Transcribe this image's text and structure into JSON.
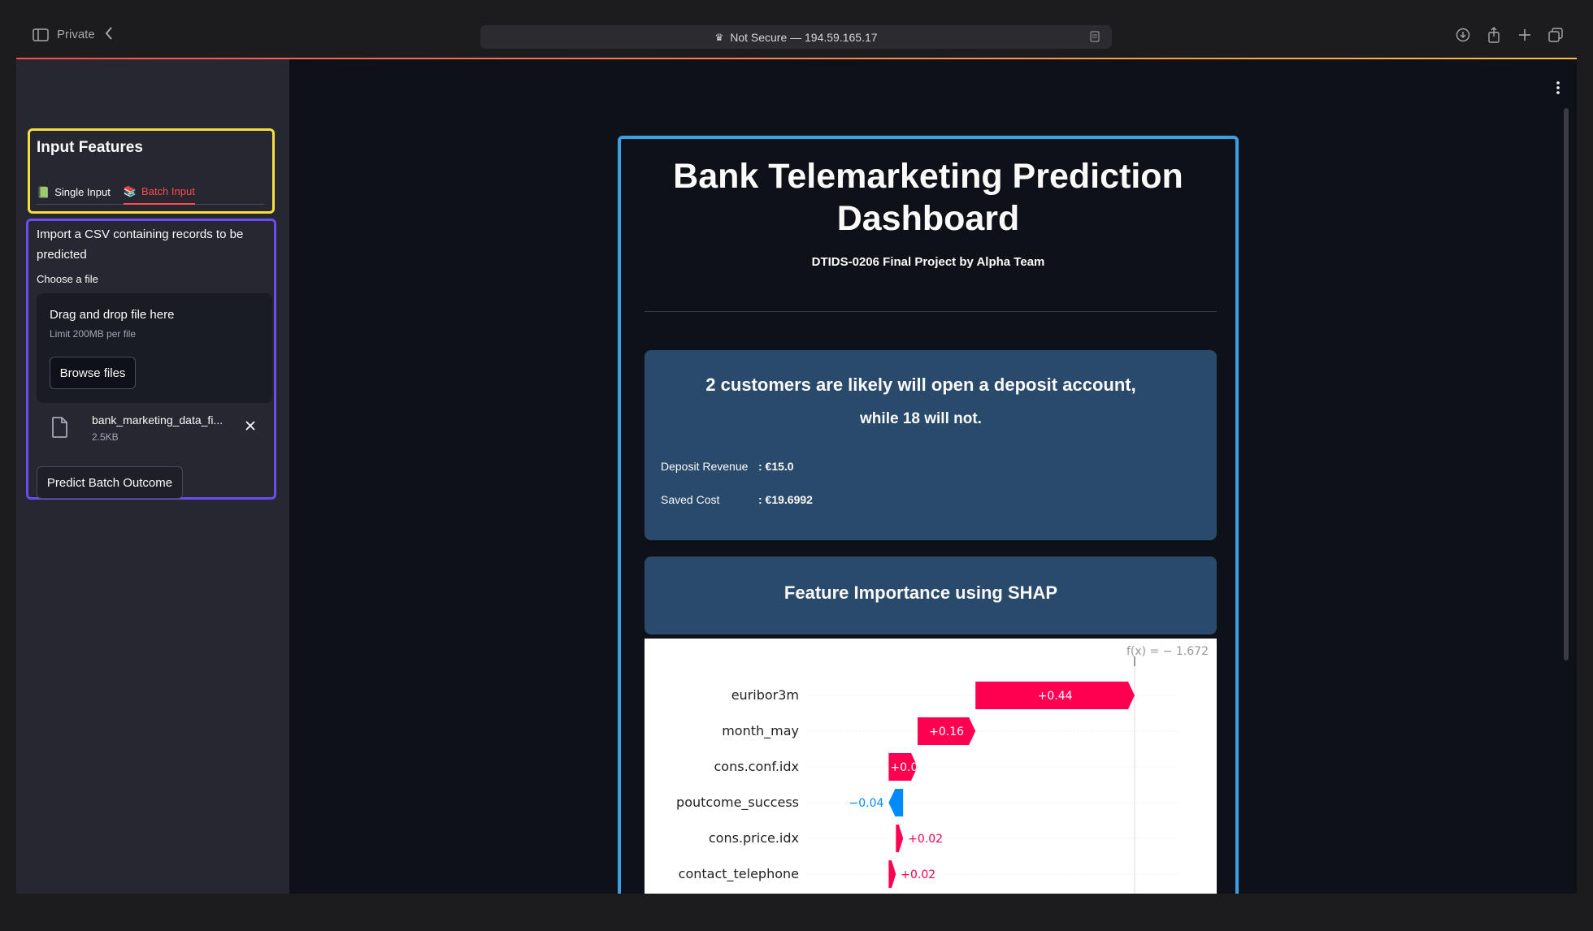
{
  "browser": {
    "private_label": "Private",
    "url": "Not Secure — 194.59.165.17"
  },
  "sidebar": {
    "heading": "Input Features",
    "tabs": [
      {
        "label": "Single Input",
        "emoji": "📗",
        "active": false
      },
      {
        "label": "Batch Input",
        "emoji": "📚",
        "active": true
      }
    ],
    "import_text": "Import a CSV containing records to be predicted",
    "choose_label": "Choose a file",
    "dropzone_title": "Drag and drop file here",
    "dropzone_limit": "Limit 200MB per file",
    "browse_label": "Browse files",
    "file": {
      "name": "bank_marketing_data_fi...",
      "size": "2.5KB"
    },
    "predict_label": "Predict Batch Outcome"
  },
  "main": {
    "title": "Bank Telemarketing Prediction Dashboard",
    "subtitle": "DTIDS-0206 Final Project by Alpha Team",
    "prediction_line1": "2 customers are likely will open a deposit account,",
    "prediction_line2": "while 18 will not.",
    "metrics": [
      {
        "label": "Deposit Revenue",
        "value": ": €15.0"
      },
      {
        "label": "Saved Cost",
        "value": ": €19.6992"
      }
    ],
    "shap_heading": "Feature Importance using SHAP"
  },
  "chart_data": {
    "type": "waterfall",
    "fx_label": "f(x) = − 1.672",
    "fx": -1.672,
    "features": [
      {
        "name": "euribor3m",
        "value": 0.44,
        "label": "+0.44"
      },
      {
        "name": "month_may",
        "value": 0.16,
        "label": "+0.16"
      },
      {
        "name": "cons.conf.idx",
        "value": 0.08,
        "label": "+0.08"
      },
      {
        "name": "poutcome_success",
        "value": -0.04,
        "label": "−0.04"
      },
      {
        "name": "cons.price.idx",
        "value": 0.02,
        "label": "+0.02"
      },
      {
        "name": "contact_telephone",
        "value": 0.02,
        "label": "+0.02"
      }
    ],
    "colors": {
      "positive": "#ff0051",
      "negative": "#008bfb"
    }
  }
}
